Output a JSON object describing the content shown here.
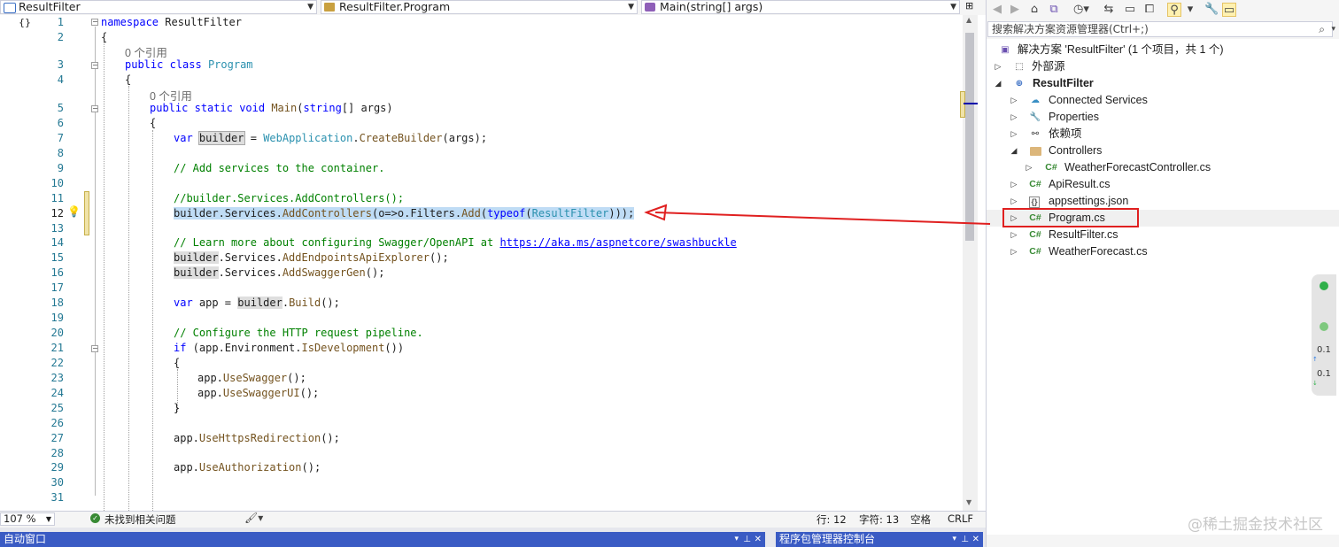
{
  "nav": {
    "project_dropdown": "ResultFilter",
    "class_dropdown": "ResultFilter.Program",
    "member_dropdown": "Main(string[] args)"
  },
  "editor": {
    "lines": [
      {
        "n": "1"
      },
      {
        "n": "2"
      },
      {
        "n": "3"
      },
      {
        "n": "4"
      },
      {
        "n": "5"
      },
      {
        "n": "6"
      },
      {
        "n": "7"
      },
      {
        "n": "8"
      },
      {
        "n": "9"
      },
      {
        "n": "10"
      },
      {
        "n": "11"
      },
      {
        "n": "12"
      },
      {
        "n": "13"
      },
      {
        "n": "14"
      },
      {
        "n": "15"
      },
      {
        "n": "16"
      },
      {
        "n": "17"
      },
      {
        "n": "18"
      },
      {
        "n": "19"
      },
      {
        "n": "20"
      },
      {
        "n": "21"
      },
      {
        "n": "22"
      },
      {
        "n": "23"
      },
      {
        "n": "24"
      },
      {
        "n": "25"
      },
      {
        "n": "26"
      },
      {
        "n": "27"
      },
      {
        "n": "28"
      },
      {
        "n": "29"
      },
      {
        "n": "30"
      },
      {
        "n": "31"
      }
    ],
    "code": {
      "l1_kw": "namespace",
      "l1_name": " ResultFilter",
      "l2": "{",
      "lens1": "0 个引用",
      "l3_kw1": "public",
      "l3_kw2": "class",
      "l3_type": "Program",
      "l4": "{",
      "lens2": "0 个引用",
      "l5_kw1": "public",
      "l5_kw2": "static",
      "l5_kw3": "void",
      "l5_method": "Main",
      "l5_open": "(",
      "l5_kw4": "string",
      "l5_rest": "[] args)",
      "l6": "{",
      "l7_kw": "var",
      "l7_var": "builder",
      "l7_eq": " = ",
      "l7_type": "WebApplication",
      "l7_dot": ".",
      "l7_method": "CreateBuilder",
      "l7_rest": "(args);",
      "l9": "// Add services to the container.",
      "l11": "//builder.Services.AddControllers();",
      "l12_a": "builder",
      "l12_b": ".Services.",
      "l12_c": "AddControllers",
      "l12_d": "(o=>o.Filters.",
      "l12_e": "Add",
      "l12_f": "(",
      "l12_g": "typeof",
      "l12_h": "(",
      "l12_i": "ResultFilter",
      "l12_j": ")));",
      "l14_comment": "// Learn more about configuring Swagger/OpenAPI at ",
      "l14_link": "https://aka.ms/aspnetcore/swashbuckle",
      "l15_a": "builder",
      "l15_b": ".Services.",
      "l15_c": "AddEndpointsApiExplorer",
      "l15_d": "();",
      "l16_a": "builder",
      "l16_b": ".Services.",
      "l16_c": "AddSwaggerGen",
      "l16_d": "();",
      "l18_kw": "var",
      "l18_b": " app = ",
      "l18_c": "builder",
      "l18_d": ".",
      "l18_e": "Build",
      "l18_f": "();",
      "l20": "// Configure the HTTP request pipeline.",
      "l21_kw": "if",
      "l21_b": " (app.Environment.",
      "l21_c": "IsDevelopment",
      "l21_d": "())",
      "l22": "{",
      "l23_a": "app.",
      "l23_b": "UseSwagger",
      "l23_c": "();",
      "l24_a": "app.",
      "l24_b": "UseSwaggerUI",
      "l24_c": "();",
      "l25": "}",
      "l27_a": "app.",
      "l27_b": "UseHttpsRedirection",
      "l27_c": "();",
      "l29_a": "app.",
      "l29_b": "UseAuthorization",
      "l29_c": "();"
    }
  },
  "status": {
    "zoom": "107 %",
    "issues": "未找到相关问题",
    "line": "行: 12",
    "col": "字符: 13",
    "whitespace": "空格",
    "eol": "CRLF"
  },
  "bottom": {
    "left_panel": "自动窗口",
    "right_panel": "程序包管理器控制台"
  },
  "solution_explorer": {
    "search_placeholder": "搜索解决方案资源管理器(Ctrl+;)",
    "solution": "解决方案 'ResultFilter' (1 个项目，共 1 个)",
    "items": [
      {
        "label": "外部源"
      },
      {
        "label": "ResultFilter"
      },
      {
        "label": "Connected Services"
      },
      {
        "label": "Properties"
      },
      {
        "label": "依赖项"
      },
      {
        "label": "Controllers"
      },
      {
        "label": "WeatherForecastController.cs"
      },
      {
        "label": "ApiResult.cs"
      },
      {
        "label": "appsettings.json"
      },
      {
        "label": "Program.cs"
      },
      {
        "label": "ResultFilter.cs"
      },
      {
        "label": "WeatherForecast.cs"
      }
    ],
    "cs_badge": "C#"
  },
  "net_widget": {
    "up": "0.1",
    "down": "0.1"
  },
  "watermark": "@稀土掘金技术社区",
  "colors": {
    "keyword": "#0000ff",
    "type": "#2b91af",
    "comment": "#008000",
    "selection": "#bfdcf5",
    "annotation": "#e02020"
  }
}
